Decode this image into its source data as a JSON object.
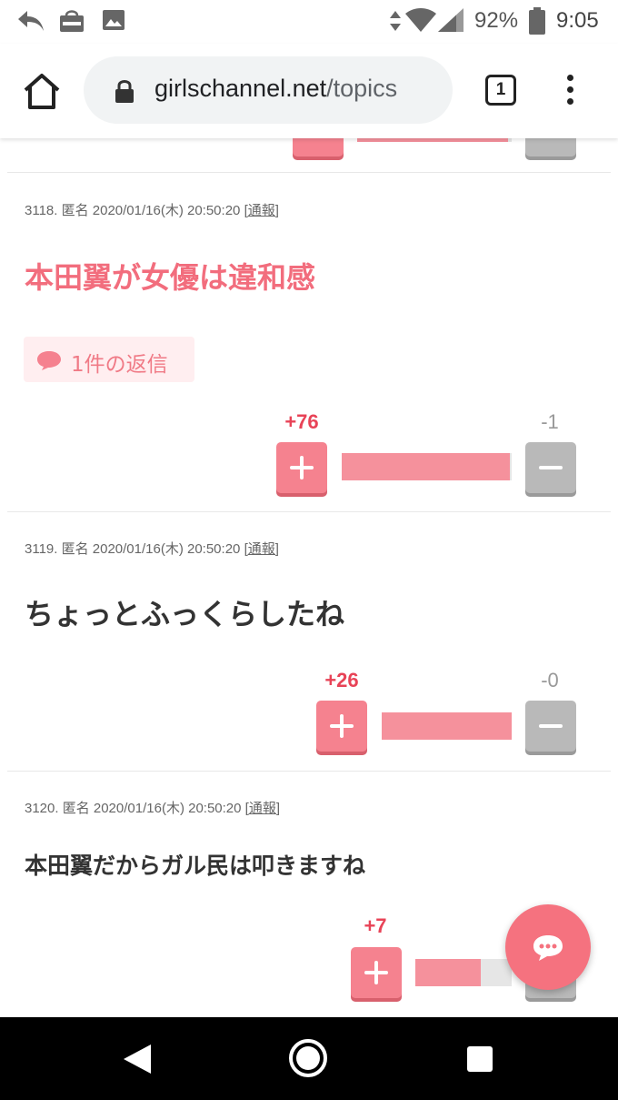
{
  "status_bar": {
    "battery": "92%",
    "time": "9:05"
  },
  "browser": {
    "url_host": "girlschannel.net",
    "url_path": "/topics",
    "tab_count": "1"
  },
  "comments": [
    {
      "meta": "3118. 匿名 2020/01/16(木) 20:50:20",
      "report": "[通報]",
      "text": "本田翼が女優は違和感",
      "text_color": "#f26d7d",
      "reply_label": "1件の返信",
      "plus": "+76",
      "minus": "-1",
      "plus_ratio": 0.987
    },
    {
      "meta": "3119. 匿名 2020/01/16(木) 20:50:20",
      "report": "[通報]",
      "text": "ちょっとふっくらしたね",
      "text_color": "#333333",
      "plus": "+26",
      "minus": "-0",
      "plus_ratio": 1.0
    },
    {
      "meta": "3120. 匿名 2020/01/16(木) 20:50:20",
      "report": "[通報]",
      "text": "本田翼だからガル民は叩きますね",
      "text_color": "#333333",
      "plus": "+7",
      "minus": "",
      "plus_ratio": 0.68
    }
  ],
  "colors": {
    "accent": "#f5828f",
    "bar_fill": "#f5919c",
    "minus_button": "#b9b9b9"
  }
}
